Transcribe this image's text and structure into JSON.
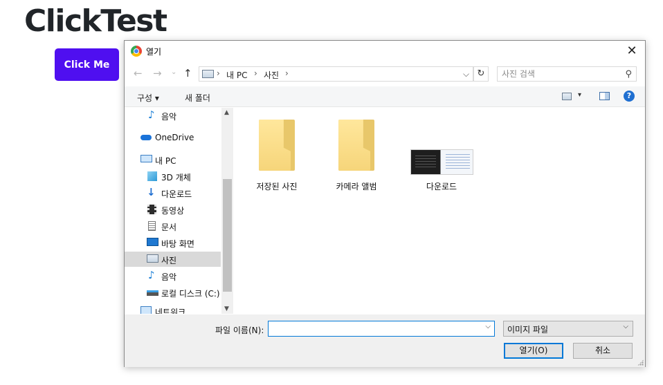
{
  "page": {
    "title": "ClickTest",
    "button_label": "Click Me",
    "button_color": "#4f0ff0"
  },
  "dialog": {
    "title": "열기",
    "title_icon": "chrome-icon",
    "close_label": "✕",
    "nav": {
      "back_icon": "arrow-left-icon",
      "forward_icon": "arrow-right-icon",
      "recent_icon": "chevron-down-icon",
      "up_icon": "arrow-up-icon"
    },
    "address": {
      "sep": "›",
      "crumbs": [
        "내 PC",
        "사진"
      ],
      "dropdown": "⌵",
      "refresh": "↻"
    },
    "search": {
      "placeholder": "사진 검색",
      "icon": "⚲"
    },
    "toolbar": {
      "organize_label": "구성 ▾",
      "new_folder_label": "새 폴더",
      "view_dropdown": "▾",
      "help_label": "?"
    },
    "sidebar": {
      "items": [
        {
          "label": "음악",
          "icon": "music-icon"
        },
        {
          "label": "OneDrive",
          "icon": "cloud-icon"
        },
        {
          "label": "내 PC",
          "icon": "pc-icon"
        },
        {
          "label": "3D 개체",
          "icon": "cube-icon"
        },
        {
          "label": "다운로드",
          "icon": "download-icon"
        },
        {
          "label": "동영상",
          "icon": "video-icon"
        },
        {
          "label": "문서",
          "icon": "document-icon"
        },
        {
          "label": "바탕 화면",
          "icon": "desktop-icon"
        },
        {
          "label": "사진",
          "icon": "pictures-icon"
        },
        {
          "label": "음악",
          "icon": "music-icon"
        },
        {
          "label": "로컬 디스크 (C:)",
          "icon": "drive-icon"
        },
        {
          "label": "네트워크",
          "icon": "network-icon"
        }
      ],
      "selected": "사진",
      "scroll_up": "▲",
      "scroll_down": "▼"
    },
    "files": [
      {
        "name": "저장된 사진",
        "icon": "folder-icon"
      },
      {
        "name": "카메라 앨범",
        "icon": "folder-icon"
      },
      {
        "name": "다운로드",
        "icon": "image-thumbnail"
      }
    ],
    "footer": {
      "filename_label": "파일 이름(N):",
      "filename_value": "",
      "filename_dropdown": "⌵",
      "filetype_value": "이미지 파일",
      "filetype_dropdown": "⌵",
      "open_label": "열기(O)",
      "cancel_label": "취소"
    }
  }
}
